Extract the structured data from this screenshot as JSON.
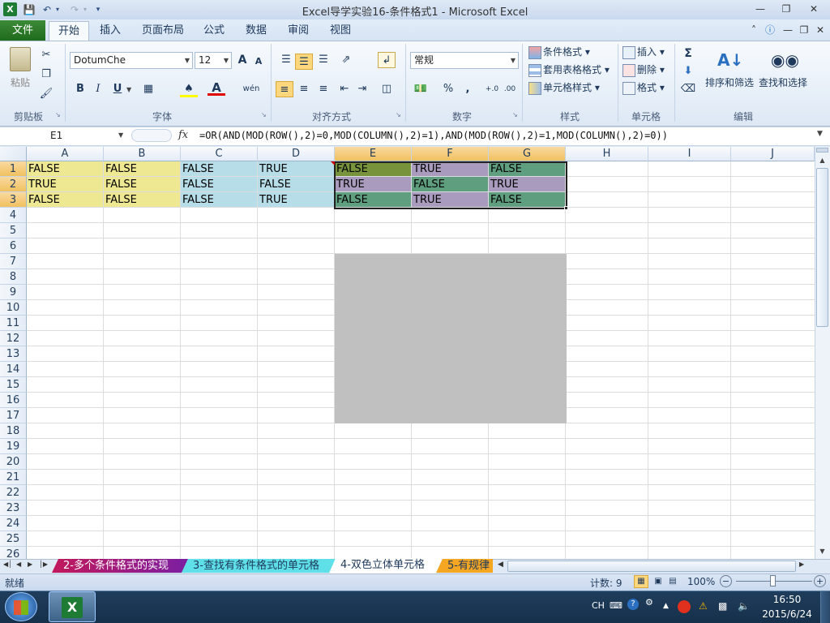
{
  "window": {
    "title": "Excel导学实验16-条件格式1 - Microsoft Excel"
  },
  "tabs": {
    "file": "文件",
    "items": [
      "开始",
      "插入",
      "页面布局",
      "公式",
      "数据",
      "审阅",
      "视图"
    ]
  },
  "clipboard": {
    "paste": "粘贴",
    "label": "剪贴板"
  },
  "font": {
    "name": "DotumChe",
    "size": "12",
    "bold": "B",
    "italic": "I",
    "underline": "U",
    "label": "字体",
    "grow": "A",
    "shrink": "A",
    "color_a": "A",
    "wen": "wén"
  },
  "alignment": {
    "label": "对齐方式"
  },
  "number": {
    "format": "常规",
    "percent": "%",
    "comma": ",",
    "label": "数字"
  },
  "styles": {
    "conditional": "条件格式",
    "table": "套用表格格式",
    "cell": "单元格样式",
    "label": "样式"
  },
  "cells": {
    "insert": "插入",
    "delete": "删除",
    "format": "格式",
    "label": "单元格"
  },
  "editing": {
    "sort": "排序和筛选",
    "find": "查找和选择",
    "label": "编辑",
    "sum": "Σ"
  },
  "formula_bar": {
    "name_box": "E1",
    "fx": "fx",
    "formula": "=OR(AND(MOD(ROW(),2)=0,MOD(COLUMN(),2)=1),AND(MOD(ROW(),2)=1,MOD(COLUMN(),2)=0))"
  },
  "columns": [
    "A",
    "B",
    "C",
    "D",
    "E",
    "F",
    "G",
    "H",
    "I",
    "J"
  ],
  "rows": [
    "1",
    "2",
    "3",
    "4",
    "5",
    "6",
    "7",
    "8",
    "9",
    "10",
    "11",
    "12",
    "13",
    "14",
    "15",
    "16",
    "17",
    "18",
    "19",
    "20",
    "21",
    "22",
    "23",
    "24",
    "25",
    "26"
  ],
  "data": [
    [
      "FALSE",
      "FALSE",
      "FALSE",
      "TRUE",
      "FALSE",
      "TRUE",
      "FALSE"
    ],
    [
      "TRUE",
      "FALSE",
      "FALSE",
      "FALSE",
      "TRUE",
      "FALSE",
      "TRUE"
    ],
    [
      "FALSE",
      "FALSE",
      "FALSE",
      "TRUE",
      "FALSE",
      "TRUE",
      "FALSE"
    ]
  ],
  "colors": {
    "yellow": "#efe893",
    "blue": "#b7dde8",
    "olive": "#77933c",
    "purple": "#a99bbd",
    "teal": "#5f9f7f",
    "gray": "#c0c0c0"
  },
  "sheets": [
    "2-多个条件格式的实现",
    "3-查找有条件格式的单元格",
    "4-双色立体单元格",
    "5-有规律"
  ],
  "status": {
    "ready": "就绪",
    "count": "计数: 9",
    "zoom": "100%"
  },
  "taskbar": {
    "lang": "CH",
    "time": "16:50",
    "date": "2015/6/24"
  }
}
